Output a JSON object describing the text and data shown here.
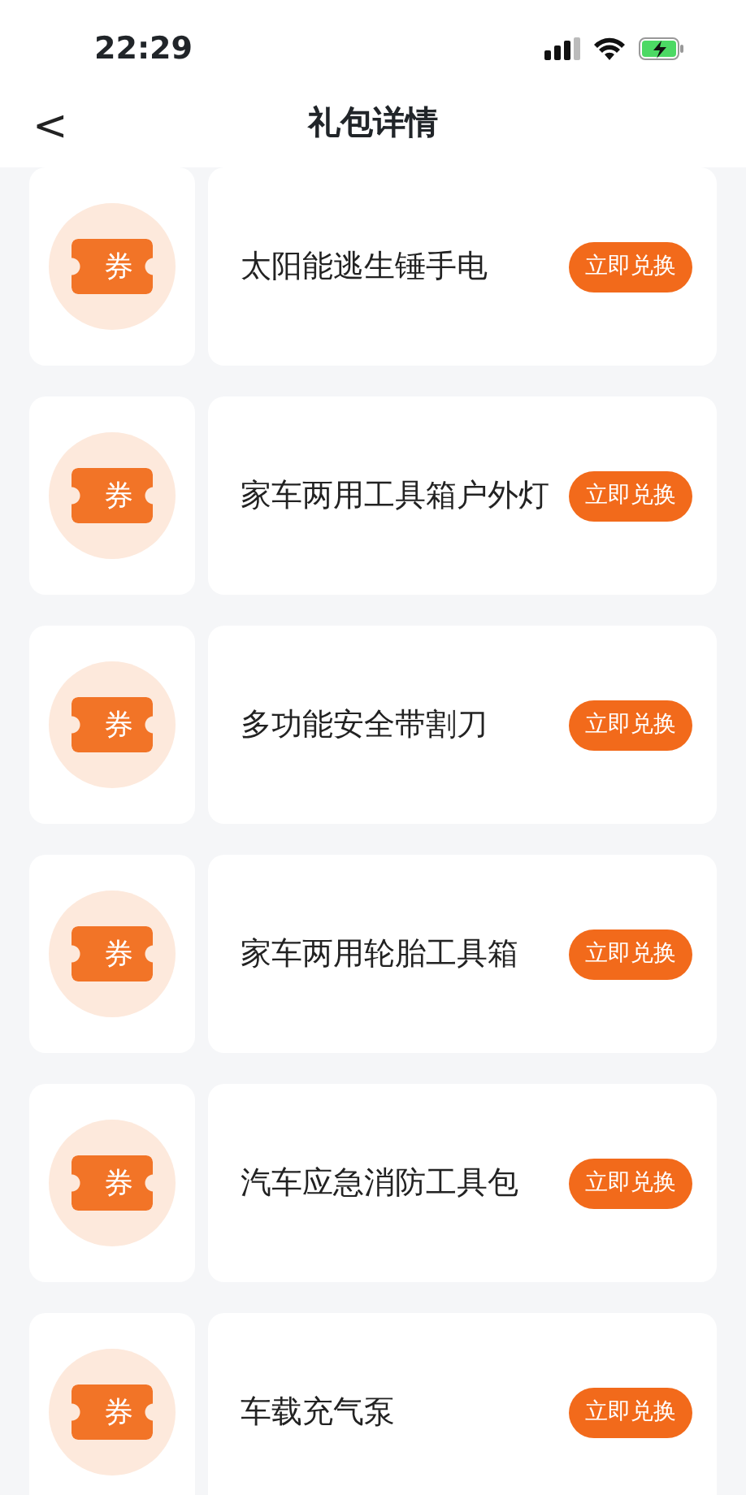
{
  "status_bar": {
    "time": "22:29"
  },
  "header": {
    "back": "<",
    "title": "礼包详情"
  },
  "gifts": [
    {
      "badge": "券",
      "name": "太阳能逃生锤手电",
      "action": "立即兑换"
    },
    {
      "badge": "券",
      "name": "家车两用工具箱户外灯",
      "action": "立即兑换"
    },
    {
      "badge": "券",
      "name": "多功能安全带割刀",
      "action": "立即兑换"
    },
    {
      "badge": "券",
      "name": "家车两用轮胎工具箱",
      "action": "立即兑换"
    },
    {
      "badge": "券",
      "name": "汽车应急消防工具包",
      "action": "立即兑换"
    },
    {
      "badge": "券",
      "name": "车载充气泵",
      "action": "立即兑换"
    }
  ]
}
